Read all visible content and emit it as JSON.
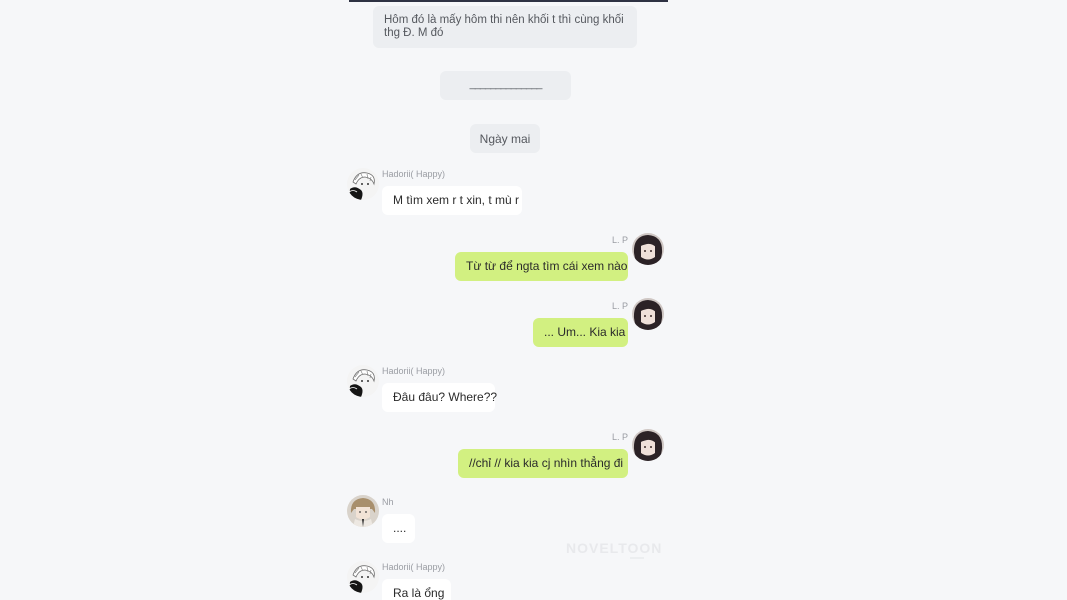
{
  "chat": {
    "narration_top": "Hôm đó là mấy hôm thi nên khối t thì cùng khối thg Đ. M đó",
    "divider": "______________",
    "scene_label": "Ngày mai",
    "messages": [
      {
        "sender": "Hadorii( Happy)",
        "text": "M tìm xem r t xin, t mù r"
      },
      {
        "sender": "L. P",
        "text": "Từ từ để ngta tìm cái xem nào"
      },
      {
        "sender": "L. P",
        "text": "... Um... Kia kia"
      },
      {
        "sender": "Hadorii( Happy)",
        "text": "Đâu đâu? Where??"
      },
      {
        "sender": "L. P",
        "text": "//chỉ // kia kia cj nhìn thẳng đi"
      },
      {
        "sender": "Nh",
        "text": "...."
      },
      {
        "sender": "Hadorii( Happy)",
        "text": "Ra là ổng"
      }
    ]
  },
  "watermark": "NOVELTOON",
  "colors": {
    "outgoing_bubble": "#d2f081",
    "incoming_bubble": "#ffffff",
    "system_bubble": "#eceef1",
    "background": "#f6f7f9"
  },
  "avatars": {
    "hadorii": "sketch-character-avatar",
    "lp": "dark-haired-character-avatar",
    "nh": "blonde-character-avatar"
  }
}
